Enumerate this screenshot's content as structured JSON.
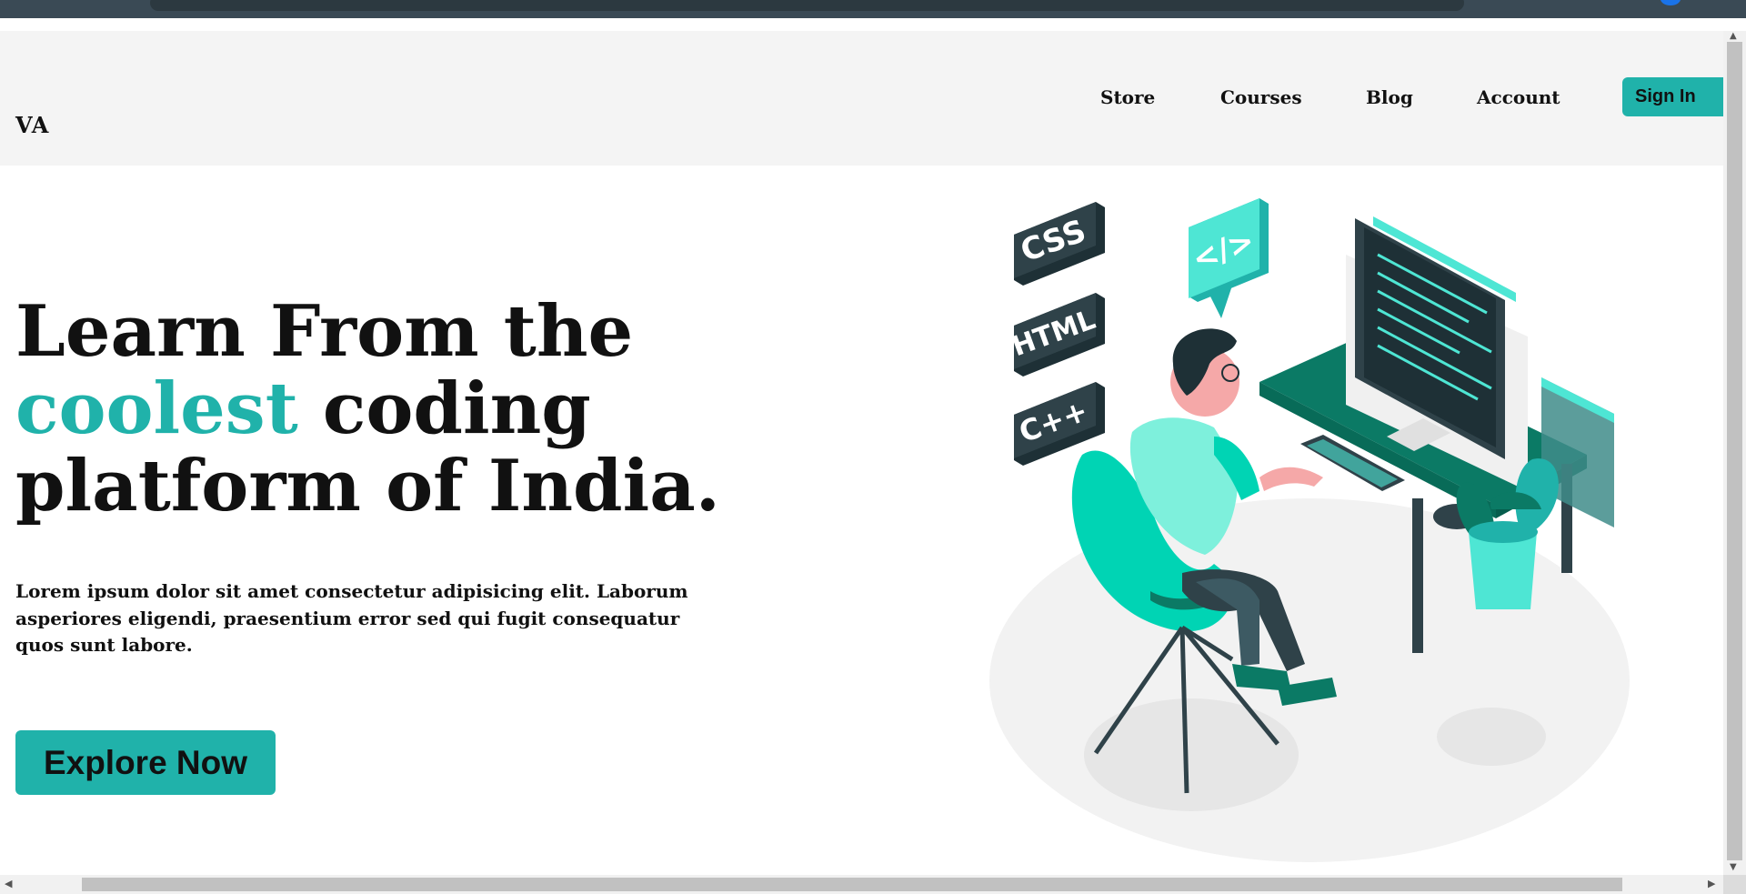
{
  "brand": {
    "logo": "VA",
    "accent": "#20b2aa"
  },
  "nav": {
    "links": [
      {
        "label": "Store"
      },
      {
        "label": "Courses"
      },
      {
        "label": "Blog"
      },
      {
        "label": "Account"
      }
    ],
    "signin_label": "Sign In"
  },
  "hero": {
    "title_part1": "Learn From the ",
    "title_accent": "coolest",
    "title_part2": " coding platform of India.",
    "description": "Lorem ipsum dolor sit amet consectetur adipisicing elit. Laborum asperiores eligendi, praesentium error sed qui fugit consequatur quos sunt labore.",
    "cta_label": "Explore Now"
  },
  "illustration": {
    "badges": [
      {
        "label": "CSS"
      },
      {
        "label": "HTML"
      },
      {
        "label": "C++"
      }
    ],
    "code_bubble": "</>"
  },
  "icons": {
    "scroll_up": "▲",
    "scroll_down": "▼",
    "scroll_left": "◀",
    "scroll_right": "▶"
  },
  "colors": {
    "teal": "#20b2aa",
    "mint": "#4ee6d4",
    "dark_slate": "#2f4249",
    "desk_green": "#0b7a65",
    "navbar_bg": "#f4f4f4"
  }
}
